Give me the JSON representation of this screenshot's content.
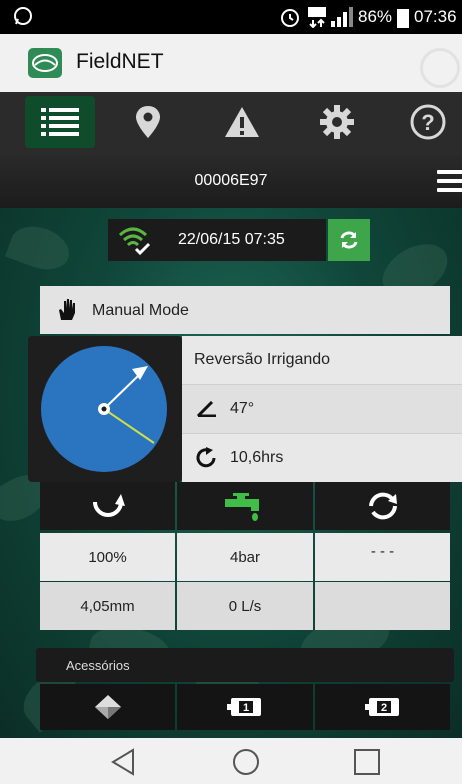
{
  "status_bar": {
    "battery": "86%",
    "time": "07:36",
    "left_icon": "whatsapp-icon",
    "icons": [
      "alarm-icon",
      "data-icon",
      "signal-icon",
      "battery-icon"
    ]
  },
  "app": {
    "title": "FieldNET",
    "logo_icon": "fieldnet-logo"
  },
  "nav": {
    "items": [
      {
        "icon": "list-icon",
        "active": true
      },
      {
        "icon": "map-pin-icon",
        "active": false
      },
      {
        "icon": "warning-icon",
        "active": false
      },
      {
        "icon": "gear-icon",
        "active": false
      },
      {
        "icon": "help-icon",
        "active": false
      }
    ]
  },
  "device": {
    "id": "00006E97"
  },
  "sync": {
    "datetime": "22/06/15 07:35",
    "icon": "wifi-check-icon",
    "refresh_icon": "refresh-icon"
  },
  "mode": {
    "label": "Manual Mode",
    "icon": "hand-icon"
  },
  "pivot": {
    "status": "Reversão Irrigando",
    "angle": "47°",
    "hours": "10,6hrs",
    "colors": {
      "field": "#2a74c0",
      "arm": "#ffffff",
      "stop_line": "#cde04a"
    }
  },
  "stats": {
    "icons": [
      "reverse-icon",
      "water-tap-icon",
      "cycle-icon"
    ],
    "rows": [
      [
        "100%",
        "4bar",
        "- - -"
      ],
      [
        "4,05mm",
        "0 L/s",
        ""
      ]
    ]
  },
  "accessories": {
    "label": "Acessórios",
    "items": [
      {
        "icon": "diamond-icon",
        "label": ""
      },
      {
        "icon": "battery-1-icon",
        "label": "1"
      },
      {
        "icon": "battery-2-icon",
        "label": "2"
      }
    ]
  },
  "theme": {
    "accent_green": "#3ea54a",
    "dark": "#1b1b1b"
  }
}
